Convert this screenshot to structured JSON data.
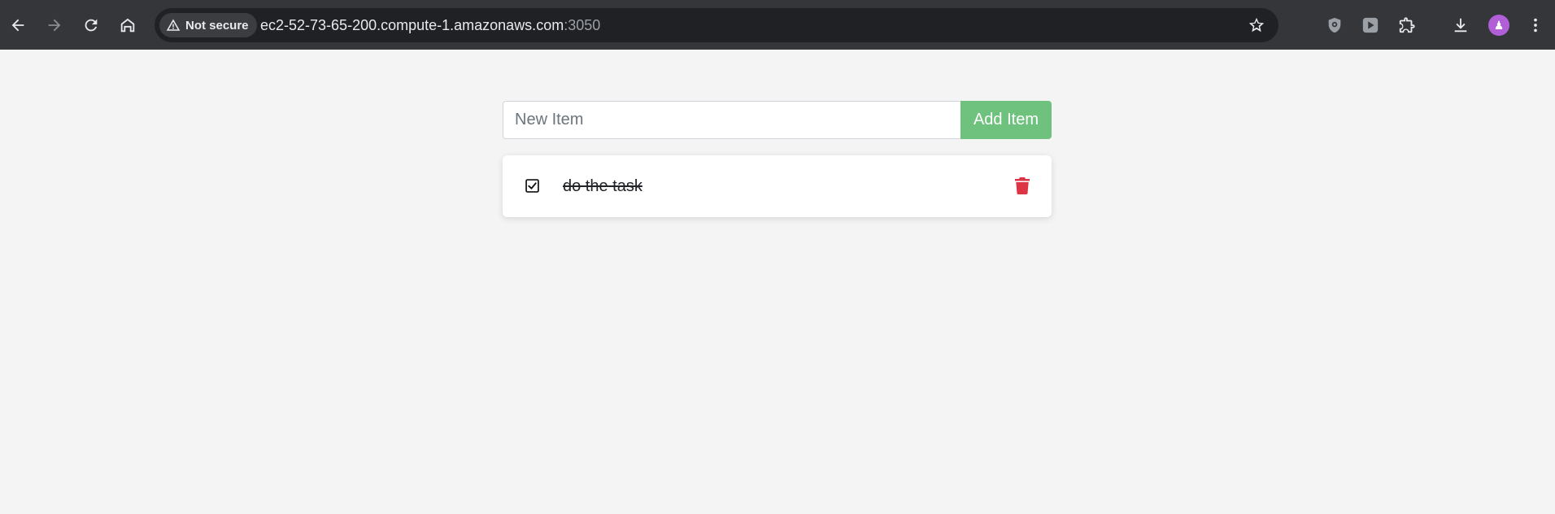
{
  "browser": {
    "security_label": "Not secure",
    "url_host": "ec2-52-73-65-200.compute-1.amazonaws.com",
    "url_port": ":3050",
    "avatar_letter": "♟"
  },
  "todo": {
    "input_placeholder": "New Item",
    "input_value": "",
    "add_button_label": "Add Item",
    "items": [
      {
        "label": "do the task",
        "completed": true
      }
    ]
  },
  "colors": {
    "add_button": "#6fc27e",
    "delete_icon": "#dc3545",
    "chrome_bg": "#35363a"
  },
  "icons": {
    "back": "arrow-left-icon",
    "forward": "arrow-right-icon",
    "reload": "reload-icon",
    "home": "home-icon",
    "warning": "warning-triangle-icon",
    "bookmark": "star-icon",
    "extension_1": "shield-icon",
    "extension_2": "play-icon",
    "extensions": "puzzle-icon",
    "downloads": "download-icon",
    "menu": "kebab-menu-icon",
    "checkbox": "checked-checkbox-icon",
    "delete": "trash-icon"
  }
}
